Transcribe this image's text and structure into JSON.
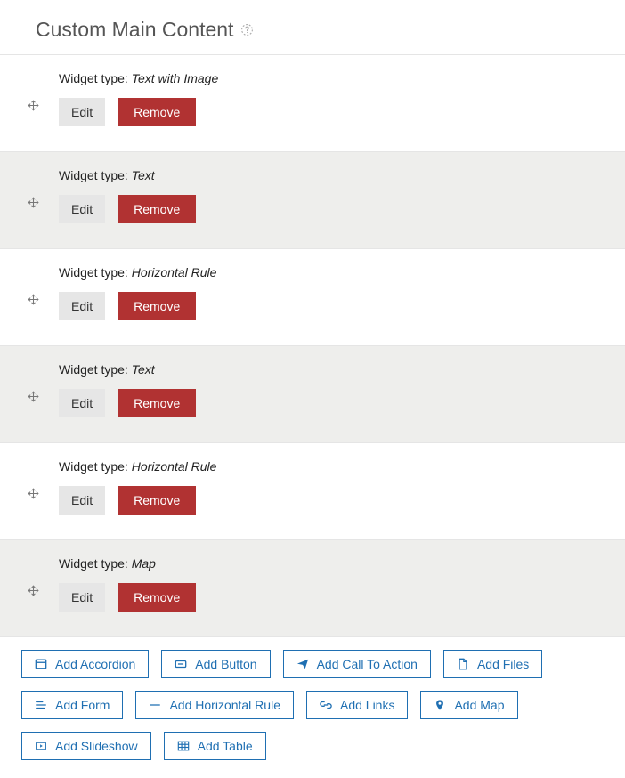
{
  "header": {
    "title": "Custom Main Content"
  },
  "widget_labels": {
    "type_prefix": "Widget type: ",
    "edit": "Edit",
    "remove": "Remove"
  },
  "widgets": [
    {
      "type": "Text with Image"
    },
    {
      "type": "Text"
    },
    {
      "type": "Horizontal Rule"
    },
    {
      "type": "Text"
    },
    {
      "type": "Horizontal Rule"
    },
    {
      "type": "Map"
    }
  ],
  "add_buttons": [
    {
      "id": "accordion",
      "label": "Add Accordion",
      "icon": "layout"
    },
    {
      "id": "button",
      "label": "Add Button",
      "icon": "button"
    },
    {
      "id": "call-to-action",
      "label": "Add Call To Action",
      "icon": "send"
    },
    {
      "id": "files",
      "label": "Add Files",
      "icon": "file"
    },
    {
      "id": "form",
      "label": "Add Form",
      "icon": "form"
    },
    {
      "id": "horizontal-rule",
      "label": "Add Horizontal Rule",
      "icon": "hr"
    },
    {
      "id": "links",
      "label": "Add Links",
      "icon": "link"
    },
    {
      "id": "map",
      "label": "Add Map",
      "icon": "pin"
    },
    {
      "id": "slideshow",
      "label": "Add Slideshow",
      "icon": "slideshow"
    },
    {
      "id": "table",
      "label": "Add Table",
      "icon": "table"
    }
  ],
  "colors": {
    "accent": "#1f6fb2",
    "danger": "#b13232",
    "row_alt": "#eeeeec"
  }
}
